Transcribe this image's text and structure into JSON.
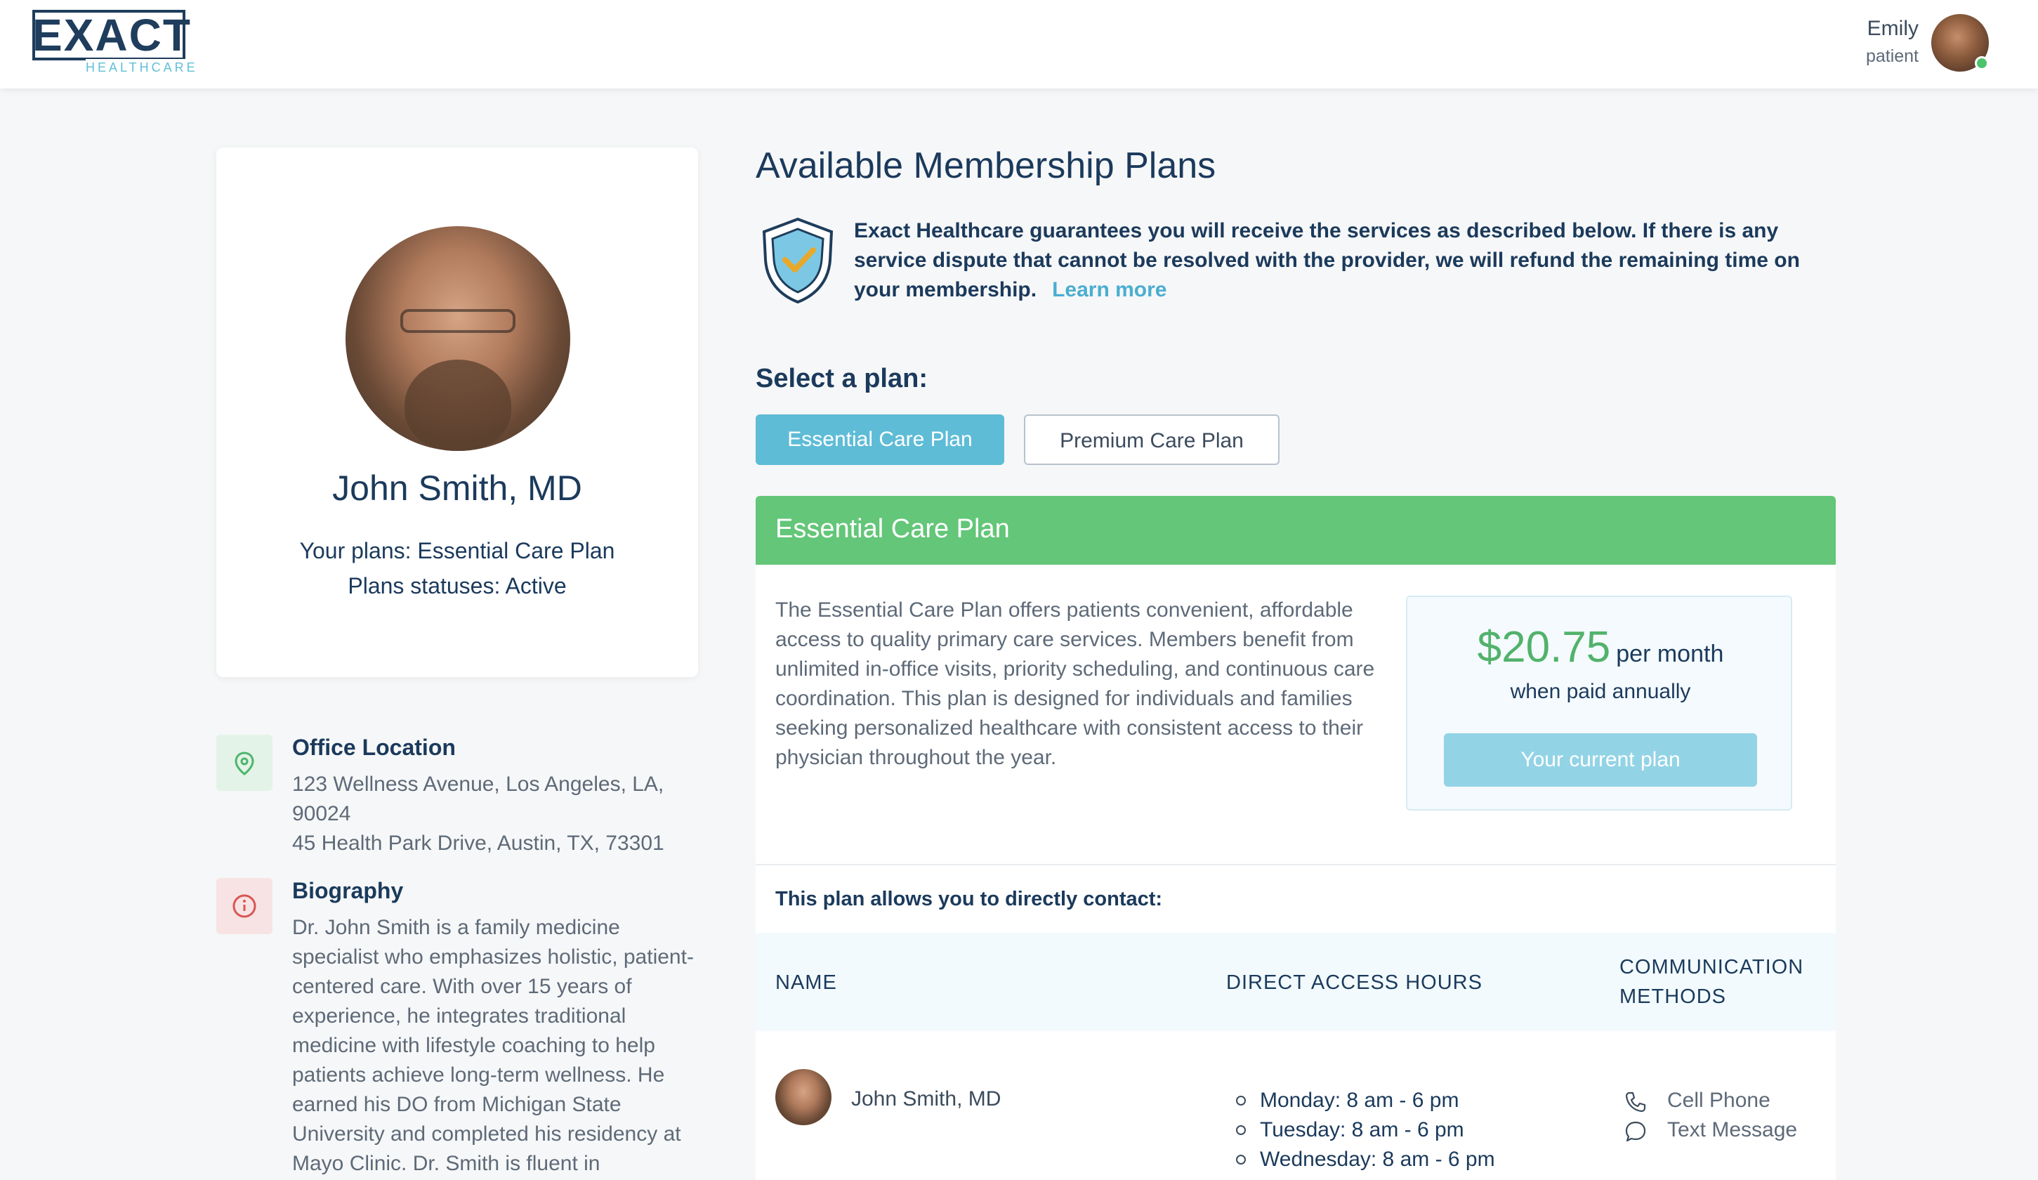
{
  "header": {
    "logo_text": "EXACT",
    "logo_subtext": "HEALTHCARE",
    "user_name": "Emily",
    "user_role": "patient"
  },
  "profile": {
    "name": "John Smith, MD",
    "plans_line": "Your plans: Essential Care Plan",
    "status_line": "Plans statuses: Active"
  },
  "office": {
    "title": "Office Location",
    "address_1": "123 Wellness Avenue, Los Angeles, LA, 90024",
    "address_2": "45 Health Park Drive, Austin, TX, 73301"
  },
  "biography": {
    "title": "Biography",
    "text": "Dr. John Smith is a family medicine specialist who emphasizes holistic, patient-centered care. With over 15 years of experience, he integrates traditional medicine with lifestyle coaching to help patients achieve long-term wellness. He earned his DO from Michigan State University and completed his residency at Mayo Clinic. Dr. Smith is fluent in"
  },
  "main": {
    "title": "Available Membership Plans",
    "guarantee_text": "Exact Healthcare guarantees you will receive the services as described below. If there is any service dispute that cannot be resolved with the provider, we will refund the remaining time on your membership.",
    "learn_more": "Learn more",
    "select_label": "Select a plan:",
    "plan_buttons": [
      "Essential Care Plan",
      "Premium Care Plan"
    ]
  },
  "plan": {
    "title": "Essential Care Plan",
    "description": "The Essential Care Plan offers patients convenient, affordable access to quality primary care services. Members benefit from unlimited in-office visits, priority scheduling, and continuous care coordination. This plan is designed for individuals and families seeking personalized healthcare with consistent access to their physician throughout the year.",
    "price": "$20.75",
    "price_unit": "per month",
    "price_note": "when paid annually",
    "current_plan_label": "Your current plan",
    "contact_label": "This plan allows you to directly contact:",
    "table_headers": {
      "name": "NAME",
      "hours": "DIRECT ACCESS HOURS",
      "comm": "COMMUNICATION METHODS"
    },
    "contact_row": {
      "name": "John Smith, MD",
      "hours": [
        "Monday: 8 am - 6 pm",
        "Tuesday: 8 am - 6 pm",
        "Wednesday: 8 am - 6 pm"
      ],
      "methods": [
        "Cell Phone",
        "Text Message"
      ]
    }
  },
  "colors": {
    "accent": "#5ebcd6",
    "plan_header": "#63c678",
    "price": "#52b26b",
    "primary_text": "#1b3a5c"
  }
}
